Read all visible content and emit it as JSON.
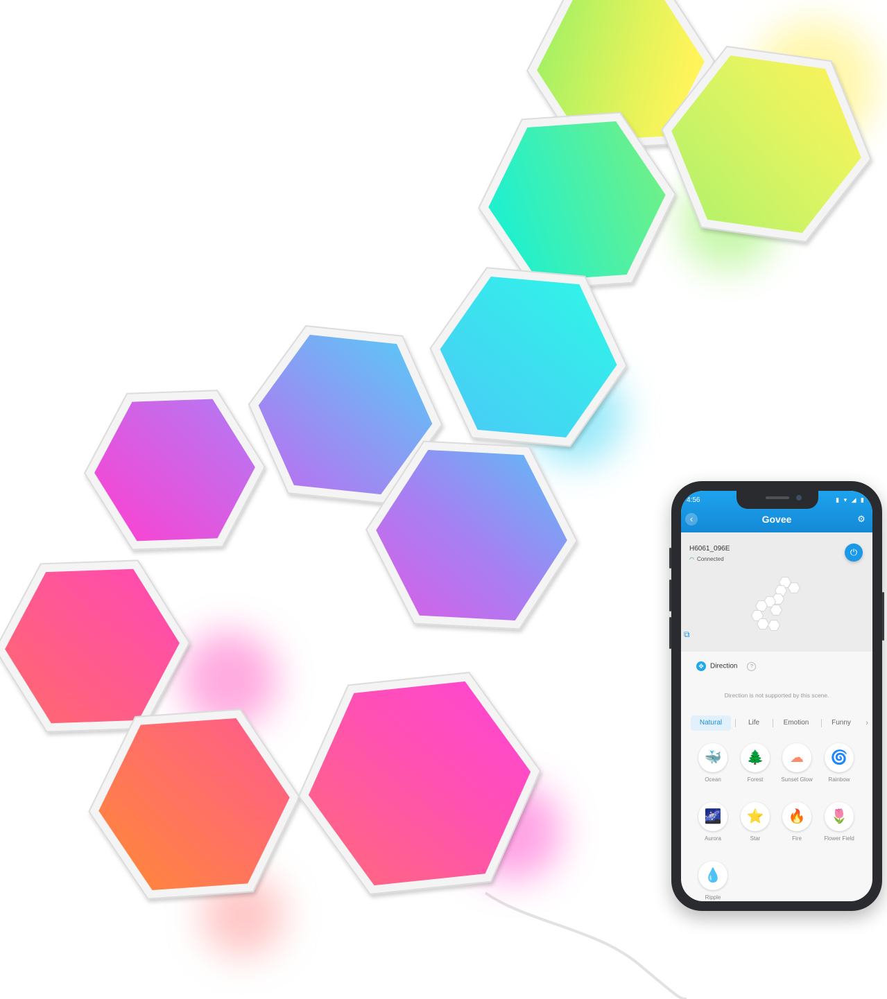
{
  "app": {
    "status_time": "4:56",
    "status_icons": "▮ ▾ ◢ ▮",
    "brand": "Govee",
    "device_name": "H6061_096E",
    "connection_status": "Connected",
    "direction_label": "Direction",
    "direction_note": "Direction is not supported by this scene.",
    "tabs": [
      {
        "label": "Natural"
      },
      {
        "label": "Life"
      },
      {
        "label": "Emotion"
      },
      {
        "label": "Funny"
      }
    ],
    "active_tab": "Natural",
    "scenes": [
      {
        "label": "Ocean",
        "icon": "whale-icon",
        "glyph": "🐳"
      },
      {
        "label": "Forest",
        "icon": "trees-icon",
        "glyph": "🌲"
      },
      {
        "label": "Sunset Glow",
        "icon": "cloud-icon",
        "glyph": "☁"
      },
      {
        "label": "Rainbow",
        "icon": "swirl-icon",
        "glyph": "🌀"
      },
      {
        "label": "Aurora",
        "icon": "aurora-icon",
        "glyph": "🌌"
      },
      {
        "label": "Star",
        "icon": "star-icon",
        "glyph": "⭐"
      },
      {
        "label": "Fire",
        "icon": "flame-icon",
        "glyph": "🔥"
      },
      {
        "label": "Flower Field",
        "icon": "tulip-icon",
        "glyph": "🌷"
      },
      {
        "label": "Ripple",
        "icon": "ripple-icon",
        "glyph": "💧"
      }
    ]
  },
  "colors": {
    "accent": "#1b98e6",
    "panel_colors": [
      "#eef55a",
      "#ccf56a",
      "#3df2c0",
      "#3de8f2",
      "#7aa8f5",
      "#b65cf2",
      "#f254b8",
      "#ff5a8c",
      "#ff7a3c"
    ]
  }
}
